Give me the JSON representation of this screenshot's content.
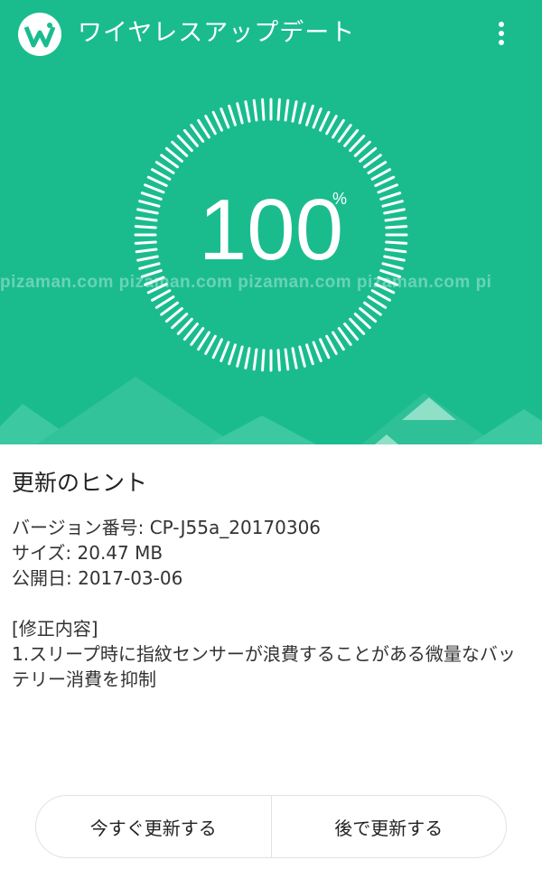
{
  "app_bar": {
    "title": "ワイヤレスアップデート",
    "logo_icon": "wireless-update-logo-icon",
    "menu_icon": "more-vert-icon"
  },
  "progress": {
    "value": "100",
    "unit": "%",
    "fraction": 1.0
  },
  "watermark": "pizaman.com pizaman.com pizaman.com pizaman.com pi",
  "hint": {
    "title": "更新のヒント",
    "version_line": "バージョン番号: CP-J55a_20170306",
    "size_line": "サイズ: 20.47 MB",
    "date_line": "公開日: 2017-03-06",
    "changes_header": "[修正内容]",
    "changes_body": "1.スリープ時に指紋センサーが浪費することがある微量なバッテリー消費を抑制"
  },
  "buttons": {
    "update_now": "今すぐ更新する",
    "update_later": "後で更新する"
  },
  "colors": {
    "accent": "#1abc8e",
    "white": "#ffffff"
  }
}
